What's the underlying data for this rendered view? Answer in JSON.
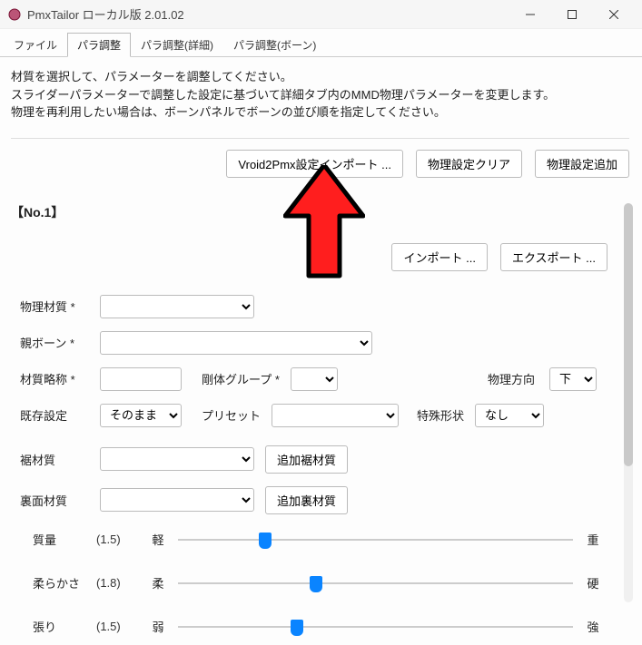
{
  "window": {
    "title": "PmxTailor ローカル版 2.01.02"
  },
  "tabs": {
    "items": [
      {
        "label": "ファイル"
      },
      {
        "label": "パラ調整"
      },
      {
        "label": "パラ調整(詳細)"
      },
      {
        "label": "パラ調整(ボーン)"
      }
    ],
    "active_index": 1
  },
  "instructions": {
    "line1": "材質を選択して、パラメーターを調整してください。",
    "line2": "スライダーパラメーターで調整した設定に基づいて詳細タブ内のMMD物理パラメーターを変更します。",
    "line3": "物理を再利用したい場合は、ボーンパネルでボーンの並び順を指定してください。"
  },
  "top_buttons": {
    "vroid_import": "Vroid2Pmx設定インポート ...",
    "physics_clear": "物理設定クリア",
    "physics_add": "物理設定追加"
  },
  "section": {
    "title": "【No.1】"
  },
  "ie_buttons": {
    "import": "インポート ...",
    "export": "エクスポート ..."
  },
  "fields": {
    "phys_material_label": "物理材質 *",
    "parent_bone_label": "親ボーン *",
    "short_name_label": "材質略称 *",
    "rigid_group_label": "剛体グループ *",
    "phys_dir_label": "物理方向",
    "phys_dir_value": "下",
    "existing_label": "既存設定",
    "existing_value": "そのまま",
    "preset_label": "プリセット",
    "special_shape_label": "特殊形状",
    "special_shape_value": "なし",
    "hem_material_label": "裾材質",
    "hem_add_btn": "追加裾材質",
    "back_material_label": "裏面材質",
    "back_add_btn": "追加裏材質"
  },
  "sliders": [
    {
      "name": "質量",
      "value": "(1.5)",
      "left": "軽",
      "right": "重",
      "pos": 22
    },
    {
      "name": "柔らかさ",
      "value": "(1.8)",
      "left": "柔",
      "right": "硬",
      "pos": 35
    },
    {
      "name": "張り",
      "value": "(1.5)",
      "left": "弱",
      "right": "強",
      "pos": 30
    }
  ]
}
